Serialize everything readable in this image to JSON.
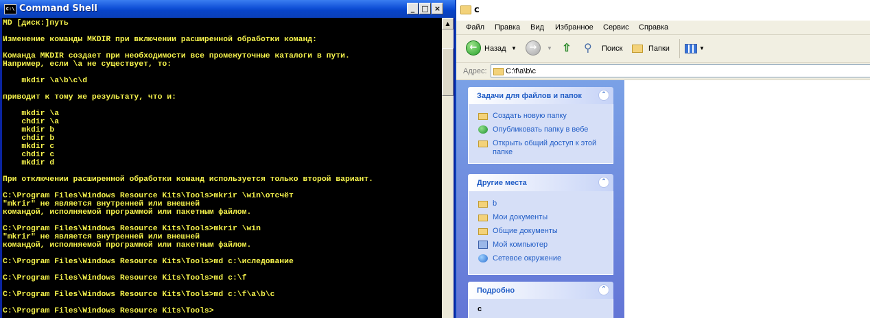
{
  "cmd": {
    "title": "Command Shell",
    "icon_text": "C:\\",
    "buttons": {
      "minimize": "_",
      "maximize": "□",
      "close": "×"
    },
    "console_text": "MD [диск:]путь\n\nИзменение команды MKDIR при включении расширенной обработки команд:\n\nКоманда MKDIR создает при необходимости все промежуточные каталоги в пути.\nНапример, если \\a не существует, то:\n\n    mkdir \\a\\b\\c\\d\n\nприводит к тому же результату, что и:\n\n    mkdir \\a\n    chdir \\a\n    mkdir b\n    chdir b\n    mkdir c\n    chdir c\n    mkdir d\n\nПри отключении расширенной обработки команд используется только второй вариант.\n\nC:\\Program Files\\Windows Resource Kits\\Tools>mkrir \\win\\отсчёт\n\"mkrir\" не является внутренней или внешней\nкомандой, исполняемой программой или пакетным файлом.\n\nC:\\Program Files\\Windows Resource Kits\\Tools>mkrir \\win\n\"mkrir\" не является внутренней или внешней\nкомандой, исполняемой программой или пакетным файлом.\n\nC:\\Program Files\\Windows Resource Kits\\Tools>md c:\\иследование\n\nC:\\Program Files\\Windows Resource Kits\\Tools>md c:\\f\n\nC:\\Program Files\\Windows Resource Kits\\Tools>md c:\\f\\a\\b\\c\n\nC:\\Program Files\\Windows Resource Kits\\Tools>",
    "colors": {
      "console_bg": "#000000",
      "console_fg": "#f7f44c"
    }
  },
  "explorer": {
    "title": "c",
    "menu": [
      "Файл",
      "Правка",
      "Вид",
      "Избранное",
      "Сервис",
      "Справка"
    ],
    "toolbar": {
      "back": "Назад",
      "search": "Поиск",
      "folders": "Папки"
    },
    "address": {
      "label": "Адрес:",
      "value": "C:\\f\\a\\b\\c"
    },
    "panels": {
      "tasks": {
        "title": "Задачи для файлов и папок",
        "items": [
          "Создать новую папку",
          "Опубликовать папку в вебе",
          "Открыть общий доступ к этой папке"
        ]
      },
      "places": {
        "title": "Другие места",
        "items": [
          "b",
          "Мои документы",
          "Общие документы",
          "Мой компьютер",
          "Сетевое окружение"
        ]
      },
      "details": {
        "title": "Подробно",
        "name": "c"
      }
    },
    "colors": {
      "panel_title": "#215dc6",
      "pane_bg": "#6c8ad9"
    }
  }
}
